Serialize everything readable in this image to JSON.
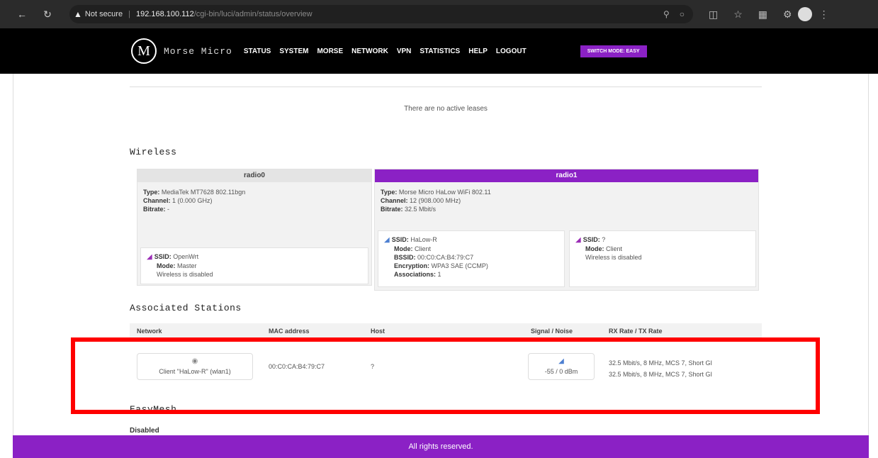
{
  "browser": {
    "security_warning": "Not secure",
    "url_host": "192.168.100.112",
    "url_path": "/cgi-bin/luci/admin/status/overview"
  },
  "header": {
    "logo_letter": "M",
    "brand": "Morse Micro",
    "menu": [
      "STATUS",
      "SYSTEM",
      "MORSE",
      "NETWORK",
      "VPN",
      "STATISTICS",
      "HELP",
      "LOGOUT"
    ],
    "mode_badge": "SWITCH MODE: EASY"
  },
  "leases": {
    "empty_text": "There are no active leases"
  },
  "wireless": {
    "title": "Wireless",
    "radio0": {
      "name": "radio0",
      "type_label": "Type:",
      "type": "MediaTek MT7628 802.11bgn",
      "channel_label": "Channel:",
      "channel": "1 (0.000 GHz)",
      "bitrate_label": "Bitrate:",
      "bitrate": "-",
      "ssid_label": "SSID:",
      "ssid": "OpenWrt",
      "mode_label": "Mode:",
      "mode": "Master",
      "status": "Wireless is disabled"
    },
    "radio1": {
      "name": "radio1",
      "type_label": "Type:",
      "type": "Morse Micro HaLow WiFi 802.11",
      "channel_label": "Channel:",
      "channel": "12 (908.000 MHz)",
      "bitrate_label": "Bitrate:",
      "bitrate": "32.5 Mbit/s",
      "net_a": {
        "ssid_label": "SSID:",
        "ssid": "HaLow-R",
        "mode_label": "Mode:",
        "mode": "Client",
        "bssid_label": "BSSID:",
        "bssid": "00:C0:CA:B4:79:C7",
        "enc_label": "Encryption:",
        "encryption": "WPA3 SAE (CCMP)",
        "assoc_label": "Associations:",
        "associations": "1"
      },
      "net_b": {
        "ssid_label": "SSID:",
        "ssid": "?",
        "mode_label": "Mode:",
        "mode": "Client",
        "status": "Wireless is disabled"
      }
    }
  },
  "stations": {
    "title": "Associated Stations",
    "columns": [
      "Network",
      "MAC address",
      "Host",
      "Signal / Noise",
      "RX Rate / TX Rate"
    ],
    "row": {
      "network": "Client \"HaLow-R\" (wlan1)",
      "mac": "00:C0:CA:B4:79:C7",
      "host": "?",
      "signal": "-55 / 0 dBm",
      "rx_rate": "32.5 Mbit/s, 8 MHz, MCS 7, Short GI",
      "tx_rate": "32.5 Mbit/s, 8 MHz, MCS 7, Short GI"
    }
  },
  "easymesh": {
    "title": "EasyMesh",
    "value": "Disabled"
  },
  "footer": {
    "text": "All rights reserved."
  },
  "colors": {
    "accent": "#8b21c5",
    "highlight": "#ff0000"
  }
}
